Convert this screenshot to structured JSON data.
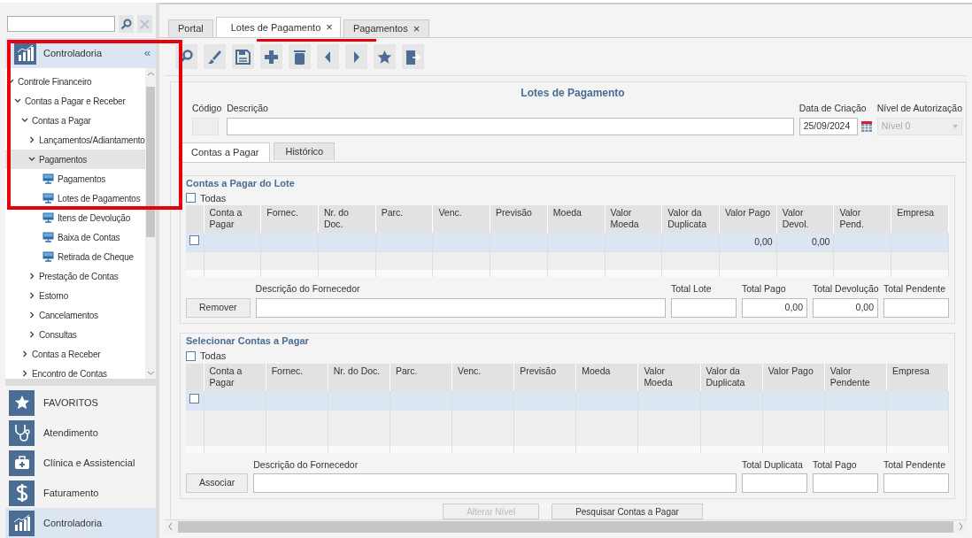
{
  "sidebar": {
    "title": "Controladoria",
    "collapse": "«",
    "tree": [
      {
        "label": "Controle Financeiro",
        "kind": "folder",
        "expanded": true,
        "selected": false,
        "children": [
          {
            "label": "Contas a Pagar e Receber",
            "kind": "folder",
            "expanded": true,
            "selected": false,
            "children": [
              {
                "label": "Contas a Pagar",
                "kind": "folder",
                "expanded": true,
                "selected": false,
                "children": [
                  {
                    "label": "Lançamentos/Adiantamento",
                    "kind": "folder",
                    "expanded": false,
                    "selected": false
                  },
                  {
                    "label": "Pagamentos",
                    "kind": "folder",
                    "expanded": true,
                    "selected": true,
                    "children": [
                      {
                        "label": "Pagamentos",
                        "kind": "screen",
                        "selected": false
                      },
                      {
                        "label": "Lotes de Pagamentos",
                        "kind": "screen",
                        "selected": false
                      },
                      {
                        "label": "Itens de Devolução",
                        "kind": "screen",
                        "selected": false
                      },
                      {
                        "label": "Baixa de Contas",
                        "kind": "screen",
                        "selected": false
                      },
                      {
                        "label": "Retirada de Cheque",
                        "kind": "screen",
                        "selected": false
                      }
                    ]
                  },
                  {
                    "label": "Prestação de Contas",
                    "kind": "folder",
                    "expanded": false,
                    "selected": false
                  },
                  {
                    "label": "Estorno",
                    "kind": "folder",
                    "expanded": false,
                    "selected": false
                  },
                  {
                    "label": "Cancelamentos",
                    "kind": "folder",
                    "expanded": false,
                    "selected": false
                  },
                  {
                    "label": "Consultas",
                    "kind": "folder",
                    "expanded": false,
                    "selected": false
                  }
                ]
              },
              {
                "label": "Contas a Receber",
                "kind": "folder",
                "expanded": false,
                "selected": false
              },
              {
                "label": "Encontro de Contas",
                "kind": "folder",
                "expanded": false,
                "selected": false
              }
            ]
          }
        ]
      }
    ]
  },
  "modules": [
    {
      "kind": "favorites",
      "label": "FAVORITOS",
      "selected": false
    },
    {
      "kind": "care",
      "label": "Atendimento",
      "selected": false
    },
    {
      "kind": "clinic",
      "label": "Clínica e Assistencial",
      "selected": false
    },
    {
      "kind": "billing",
      "label": "Faturamento",
      "selected": false
    },
    {
      "kind": "controlling",
      "label": "Controladoria",
      "selected": true
    }
  ],
  "tabs": [
    {
      "label": "Portal",
      "selected": false
    },
    {
      "label": "Lotes de Pagamento",
      "selected": true,
      "close": "×"
    },
    {
      "label": "Pagamentos",
      "selected": false,
      "close": "×"
    }
  ],
  "toolbar": [
    {
      "kind": "search"
    },
    {
      "kind": "brush"
    },
    {
      "kind": "save"
    },
    {
      "kind": "add"
    },
    {
      "kind": "delete"
    },
    {
      "kind": "previous"
    },
    {
      "kind": "next"
    },
    {
      "kind": "favorite"
    },
    {
      "kind": "exit"
    }
  ],
  "form": {
    "title": "Lotes de Pagamento",
    "fields": [
      {
        "label": "Código",
        "kind": "code",
        "disabled": true
      },
      {
        "label": "Descrição",
        "kind": "text",
        "disabled": false
      },
      {
        "label": "Data de Criação",
        "kind": "date",
        "value": "25/09/2024",
        "disabled": false
      },
      {
        "label": "Nível de Autorização",
        "kind": "select",
        "value": "Nível 0",
        "disabled": true
      }
    ],
    "subtabs": [
      {
        "label": "Contas a Pagar",
        "selected": true
      },
      {
        "label": "Histórico",
        "selected": false
      }
    ],
    "groups": [
      {
        "title": "Contas a Pagar do Lote",
        "select_all": {
          "label": "Todas",
          "checked": false
        },
        "columns": [
          "Conta a Pagar",
          "Fornec.",
          "Nr. do Doc.",
          "Parc.",
          "Venc.",
          "Previsão",
          "Moeda",
          "Valor Moeda",
          "Valor da Duplicata",
          "Valor Pago",
          "Valor Devol.",
          "Valor Pend.",
          "Empresa"
        ],
        "rows": [
          {
            "selected": true,
            "checked": false,
            "cells": [
              null,
              null,
              null,
              null,
              null,
              null,
              null,
              null,
              null,
              "0,00",
              "0,00",
              null,
              null
            ]
          }
        ],
        "button": "Remover",
        "totals": [
          {
            "label": "Descrição do Fornecedor",
            "kind": "wide"
          },
          {
            "label": "Total Lote",
            "kind": "total"
          },
          {
            "label": "Total Pago",
            "kind": "total",
            "value": "0,00"
          },
          {
            "label": "Total Devolução",
            "kind": "total",
            "value": "0,00"
          },
          {
            "label": "Total Pendente",
            "kind": "total"
          }
        ]
      },
      {
        "title": "Selecionar Contas a Pagar",
        "select_all": {
          "label": "Todas",
          "checked": false
        },
        "columns": [
          "Conta a Pagar",
          "Fornec.",
          "Nr. do Doc.",
          "Parc.",
          "Venc.",
          "Previsão",
          "Moeda",
          "Valor Moeda",
          "Valor da Duplicata",
          "Valor Pago",
          "Valor Pendente",
          "Empresa"
        ],
        "rows": [
          {
            "selected": true,
            "checked": false
          }
        ],
        "button": "Associar",
        "totals": [
          {
            "label": "Descrição do Fornecedor",
            "kind": "wide"
          },
          {
            "label": "Total Duplicata",
            "kind": "total"
          },
          {
            "label": "Total Pago",
            "kind": "total"
          },
          {
            "label": "Total Pendente",
            "kind": "total"
          }
        ]
      }
    ],
    "buttons": [
      {
        "label": "Alterar Nível",
        "disabled": true
      },
      {
        "label": "Pesquisar Contas a Pagar",
        "disabled": false
      }
    ]
  },
  "annotations": {
    "sidebar_box": true,
    "tab_underline": true
  }
}
